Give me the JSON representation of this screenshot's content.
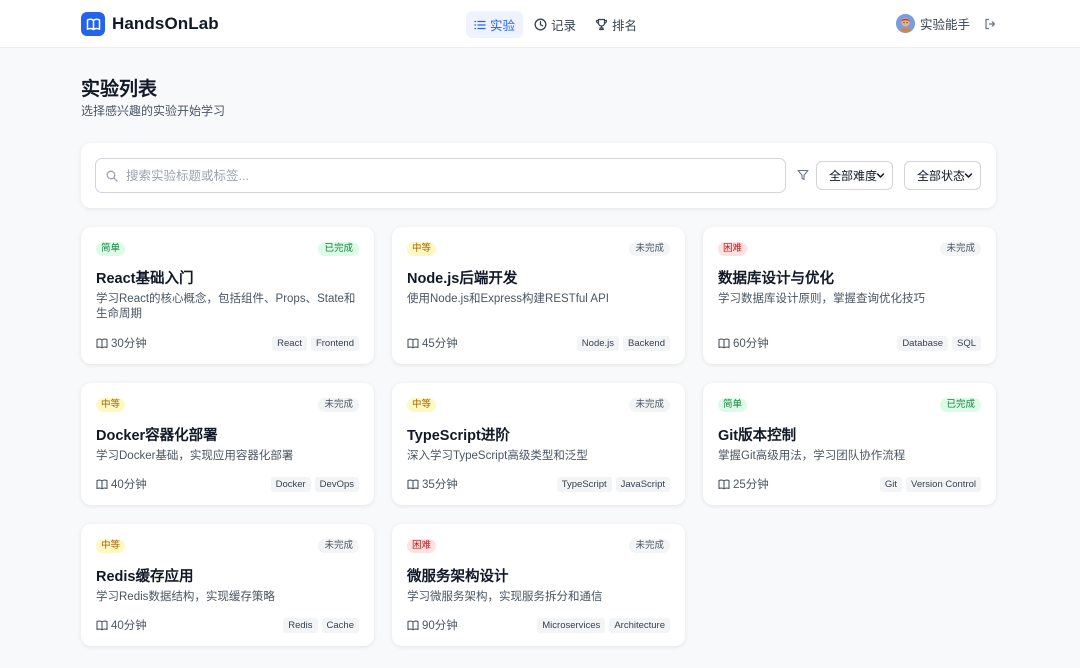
{
  "header": {
    "app_name": "HandsOnLab",
    "nav": [
      {
        "label": "实验",
        "icon": "list-icon",
        "active": true
      },
      {
        "label": "记录",
        "icon": "clock-icon",
        "active": false
      },
      {
        "label": "排名",
        "icon": "trophy-icon",
        "active": false
      }
    ],
    "user_name": "实验能手"
  },
  "page": {
    "title": "实验列表",
    "subtitle": "选择感兴趣的实验开始学习"
  },
  "filters": {
    "search_placeholder": "搜索实验标题或标签...",
    "search_value": "",
    "difficulty_selected": "全部难度",
    "status_selected": "全部状态"
  },
  "colors": {
    "accent": "#2563eb",
    "easy_bg": "#dcfce7",
    "easy_fg": "#15803d",
    "medium_bg": "#fef9c3",
    "medium_fg": "#a16207",
    "hard_bg": "#fee2e2",
    "hard_fg": "#b91c1c",
    "done_bg": "#dcfce7",
    "done_fg": "#15803d",
    "todo_bg": "#f3f4f6",
    "todo_fg": "#4b5563"
  },
  "labs": [
    {
      "difficulty": "简单",
      "difficulty_level": "easy",
      "status": "已完成",
      "completed": true,
      "title": "React基础入门",
      "desc": "学习React的核心概念，包括组件、Props、State和生命周期",
      "duration": "30分钟",
      "tags": [
        "React",
        "Frontend"
      ]
    },
    {
      "difficulty": "中等",
      "difficulty_level": "medium",
      "status": "未完成",
      "completed": false,
      "title": "Node.js后端开发",
      "desc": "使用Node.js和Express构建RESTful API",
      "duration": "45分钟",
      "tags": [
        "Node.js",
        "Backend"
      ]
    },
    {
      "difficulty": "困难",
      "difficulty_level": "hard",
      "status": "未完成",
      "completed": false,
      "title": "数据库设计与优化",
      "desc": "学习数据库设计原则，掌握查询优化技巧",
      "duration": "60分钟",
      "tags": [
        "Database",
        "SQL"
      ]
    },
    {
      "difficulty": "中等",
      "difficulty_level": "medium",
      "status": "未完成",
      "completed": false,
      "title": "Docker容器化部署",
      "desc": "学习Docker基础，实现应用容器化部署",
      "duration": "40分钟",
      "tags": [
        "Docker",
        "DevOps"
      ]
    },
    {
      "difficulty": "中等",
      "difficulty_level": "medium",
      "status": "未完成",
      "completed": false,
      "title": "TypeScript进阶",
      "desc": "深入学习TypeScript高级类型和泛型",
      "duration": "35分钟",
      "tags": [
        "TypeScript",
        "JavaScript"
      ]
    },
    {
      "difficulty": "简单",
      "difficulty_level": "easy",
      "status": "已完成",
      "completed": true,
      "title": "Git版本控制",
      "desc": "掌握Git高级用法，学习团队协作流程",
      "duration": "25分钟",
      "tags": [
        "Git",
        "Version Control"
      ]
    },
    {
      "difficulty": "中等",
      "difficulty_level": "medium",
      "status": "未完成",
      "completed": false,
      "title": "Redis缓存应用",
      "desc": "学习Redis数据结构，实现缓存策略",
      "duration": "40分钟",
      "tags": [
        "Redis",
        "Cache"
      ]
    },
    {
      "difficulty": "困难",
      "difficulty_level": "hard",
      "status": "未完成",
      "completed": false,
      "title": "微服务架构设计",
      "desc": "学习微服务架构，实现服务拆分和通信",
      "duration": "90分钟",
      "tags": [
        "Microservices",
        "Architecture"
      ]
    }
  ]
}
